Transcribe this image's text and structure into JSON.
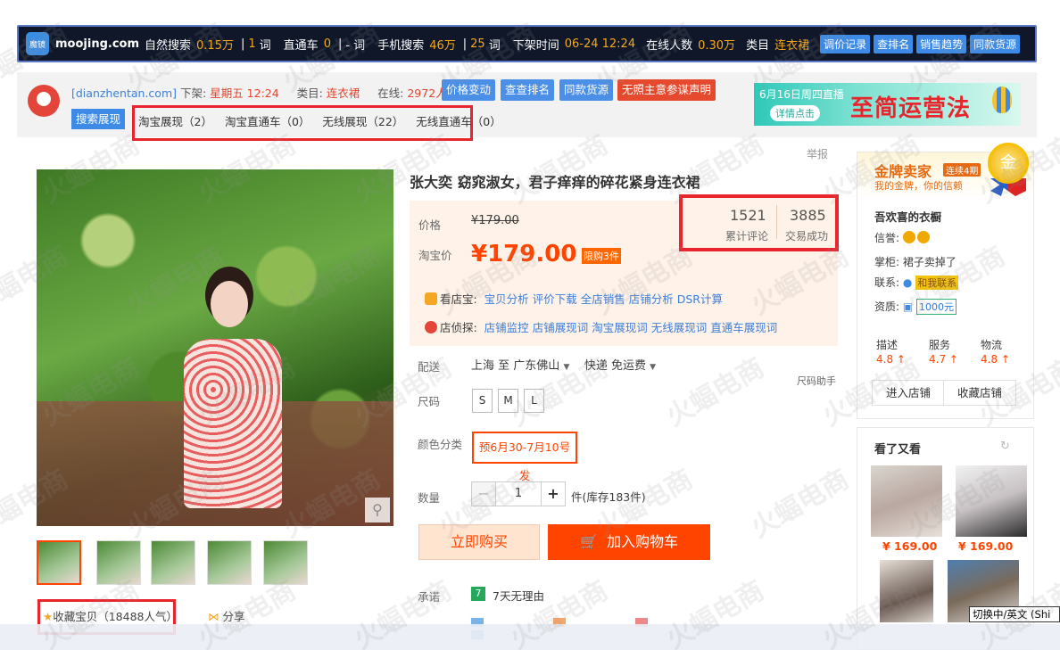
{
  "topbar": {
    "logo_text": "魔镜",
    "site": "moojing.com",
    "natural_search_label": "自然搜索",
    "natural_search_value": "0.15万",
    "natural_search_words": "1",
    "word_unit": "词",
    "through_train_label": "直通车",
    "through_train_value": "0",
    "through_train_words": "- 词",
    "mobile_search_label": "手机搜索",
    "mobile_search_value": "46万",
    "mobile_search_words": "25",
    "offshelf_label": "下架时间",
    "offshelf_value": "06-24 12:24",
    "online_label": "在线人数",
    "online_value": "0.30万",
    "category_label": "类目",
    "category_value": "连衣裙",
    "buttons": [
      "调价记录",
      "查排名",
      "销售趋势",
      "同款货源"
    ]
  },
  "strip": {
    "shop_domain": "[dianzhentan.com]",
    "offshelf_label": "下架:",
    "offshelf_value": "星期五 12:24",
    "category_label": "类目:",
    "category_value": "连衣裙",
    "online_label": "在线:",
    "online_value": "2972人",
    "buttons": [
      "价格变动",
      "查查排名",
      "同款货源"
    ],
    "red_button": "无照主意参谋声明",
    "search_tab": "搜索展现",
    "exposure": [
      "淘宝展现（2）",
      "淘宝直通车（0）",
      "无线展现（22）",
      "无线直通车（0）"
    ]
  },
  "banner": {
    "date_text": "6月16日周四直播",
    "detail_btn": "详情点击",
    "headline": "至简运营法"
  },
  "product": {
    "title": "张大奕 窈窕淑女，君子痒痒的碎花紧身连衣裙",
    "report": "举报",
    "price_label": "价格",
    "original_price": "¥179.00",
    "taobao_price_label": "淘宝价",
    "current_price": "¥179.00",
    "limit_tag": "限购3件",
    "reviews_count": "1521",
    "reviews_label": "累计评论",
    "deals_count": "3885",
    "deals_label": "交易成功",
    "tool1_label": "看店宝:",
    "tool1_links": [
      "宝贝分析",
      "评价下载",
      "全店销售",
      "店铺分析",
      "DSR计算"
    ],
    "tool2_label": "店侦探:",
    "tool2_links": [
      "店铺监控",
      "店铺展现词",
      "淘宝展现词",
      "无线展现词",
      "直通车展现词"
    ],
    "delivery_label": "配送",
    "delivery_from": "上海 至",
    "delivery_to": "广东佛山",
    "delivery_method": "快递 免运费",
    "size_helper": "尺码助手",
    "size_label": "尺码",
    "sizes": [
      "S",
      "M",
      "L"
    ],
    "color_label": "颜色分类",
    "color_option": "预6月30-7月10号发",
    "qty_label": "数量",
    "qty_value": "1",
    "qty_minus": "−",
    "qty_plus": "+",
    "stock_text": "件(库存183件)",
    "buy_now": "立即购买",
    "add_cart": "加入购物车",
    "promise_label": "承诺",
    "promise_icon": "7",
    "promise_text": "7天无理由",
    "favorite": "收藏宝贝（18488人气）",
    "share": "分享"
  },
  "shop": {
    "gold_title": "金牌卖家",
    "gold_badge": "连续4期",
    "gold_sub": "我的金牌，你的信赖",
    "medal": "金",
    "name": "吾欢喜的衣橱",
    "credit_label": "信誉:",
    "keeper_label": "掌柜:",
    "keeper_value": "裙子卖掉了",
    "contact_label": "联系:",
    "contact_value": "和我联系",
    "qual_label": "资质:",
    "qual_value": "1000元",
    "score_labels": [
      "描述",
      "服务",
      "物流"
    ],
    "score_values": [
      "4.8 ↑",
      "4.7 ↑",
      "4.8 ↑"
    ],
    "enter_shop": "进入店铺",
    "collect_shop": "收藏店铺"
  },
  "also": {
    "title": "看了又看",
    "refresh": "↻",
    "prices": [
      "¥ 169.00",
      "¥ 169.00"
    ]
  },
  "ime_text": "切换中/英文 (Shi",
  "watermark": "火蝠电商",
  "colors": {
    "accent": "#ff4400",
    "plugin_blue": "#3d8be6",
    "highlight_red": "#e8252d"
  }
}
